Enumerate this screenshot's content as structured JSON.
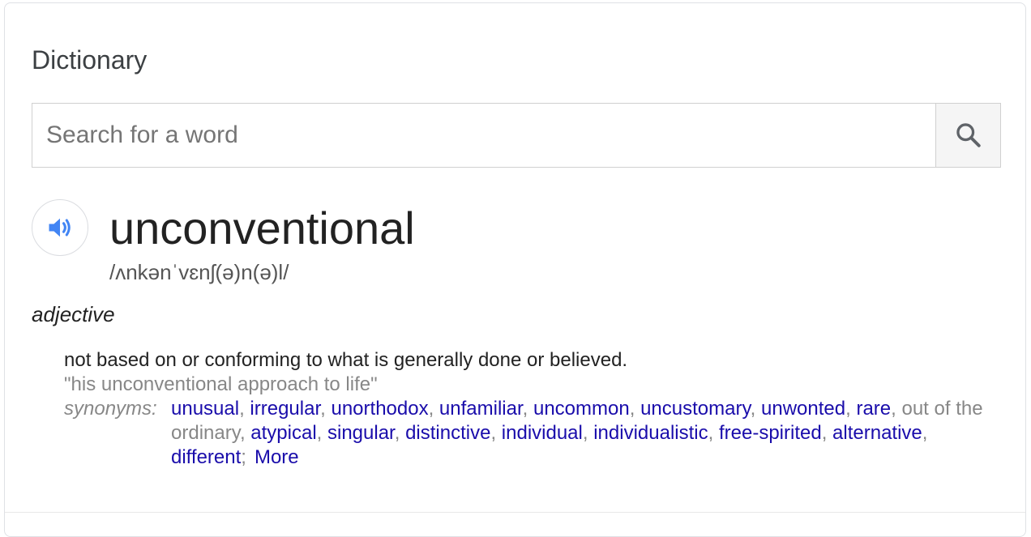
{
  "card": {
    "title": "Dictionary"
  },
  "search": {
    "placeholder": "Search for a word",
    "value": "",
    "button_icon": "search-icon"
  },
  "entry": {
    "speaker_icon": "speaker-icon",
    "headword": "unconventional",
    "phonetic": "/ʌnkənˈvɛnʃ(ə)n(ə)l/",
    "part_of_speech": "adjective",
    "definition": "not based on or conforming to what is generally done or believed.",
    "example": "\"his unconventional approach to life\"",
    "synonyms_label": "synonyms:",
    "synonyms": [
      {
        "text": "unusual",
        "link": true
      },
      {
        "text": "irregular",
        "link": true
      },
      {
        "text": "unorthodox",
        "link": true
      },
      {
        "text": "unfamiliar",
        "link": true
      },
      {
        "text": "uncommon",
        "link": true
      },
      {
        "text": "uncustomary",
        "link": true
      },
      {
        "text": "unwonted",
        "link": true
      },
      {
        "text": "rare",
        "link": true
      },
      {
        "text": "out of the ordinary",
        "link": false
      },
      {
        "text": "atypical",
        "link": true
      },
      {
        "text": "singular",
        "link": true
      },
      {
        "text": "distinctive",
        "link": true
      },
      {
        "text": "individual",
        "link": true
      },
      {
        "text": "individualistic",
        "link": true
      },
      {
        "text": "free-spirited",
        "link": true
      },
      {
        "text": "alternative",
        "link": true
      },
      {
        "text": "different",
        "link": true
      }
    ],
    "more_label": "More"
  },
  "colors": {
    "link": "#1a0dab",
    "muted": "#878787",
    "speaker_blue": "#4285f4"
  }
}
